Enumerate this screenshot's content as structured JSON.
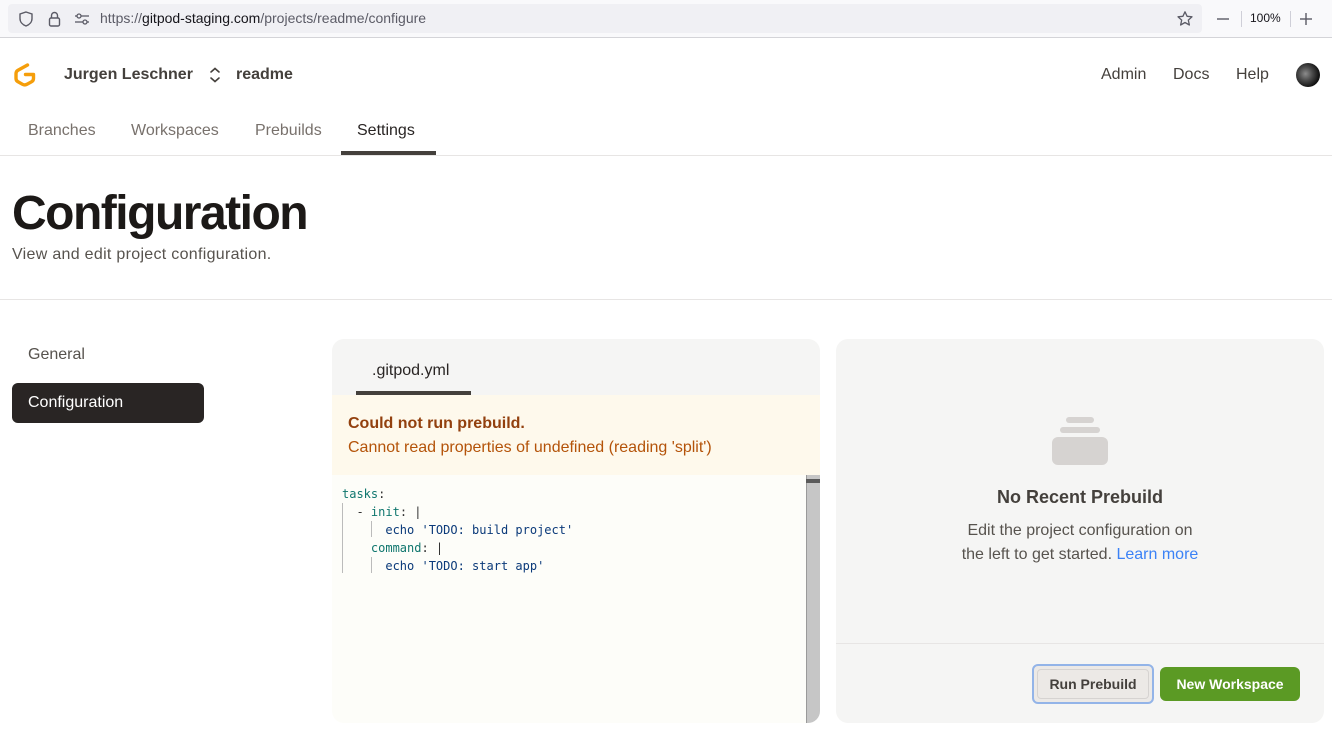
{
  "browser": {
    "url_prefix": "https://",
    "url_host": "gitpod-staging.com",
    "url_path": "/projects/readme/configure",
    "zoom": "100%"
  },
  "header": {
    "user": "Jurgen Leschner",
    "project": "readme",
    "nav": [
      "Admin",
      "Docs",
      "Help"
    ]
  },
  "tabs": {
    "items": [
      "Branches",
      "Workspaces",
      "Prebuilds",
      "Settings"
    ],
    "active": "Settings"
  },
  "page": {
    "title": "Configuration",
    "subtitle": "View and edit project configuration."
  },
  "sidebar": {
    "items": [
      "General",
      "Configuration"
    ],
    "active": "Configuration"
  },
  "editor": {
    "file_tab": ".gitpod.yml",
    "error_title": "Could not run prebuild.",
    "error_message": "Cannot read properties of undefined (reading 'split')",
    "code": {
      "l1_key": "tasks",
      "l1_sep": ":",
      "l2_dash": "- ",
      "l2_key": "init",
      "l2_sep": ": |",
      "l3_str": "echo 'TODO: build project'",
      "l4_key": "command",
      "l4_sep": ": |",
      "l5_str": "echo 'TODO: start app'"
    }
  },
  "prebuild": {
    "title": "No Recent Prebuild",
    "desc_line1": "Edit the project configuration on",
    "desc_line2": "the left to get started.",
    "learn_more": "Learn more",
    "run_button": "Run Prebuild",
    "new_workspace_button": "New Workspace"
  },
  "colors": {
    "accent_green": "#5b9a24",
    "error_bg": "#fef9ec",
    "error_title": "#92400e",
    "link_blue": "#3b82f6"
  }
}
